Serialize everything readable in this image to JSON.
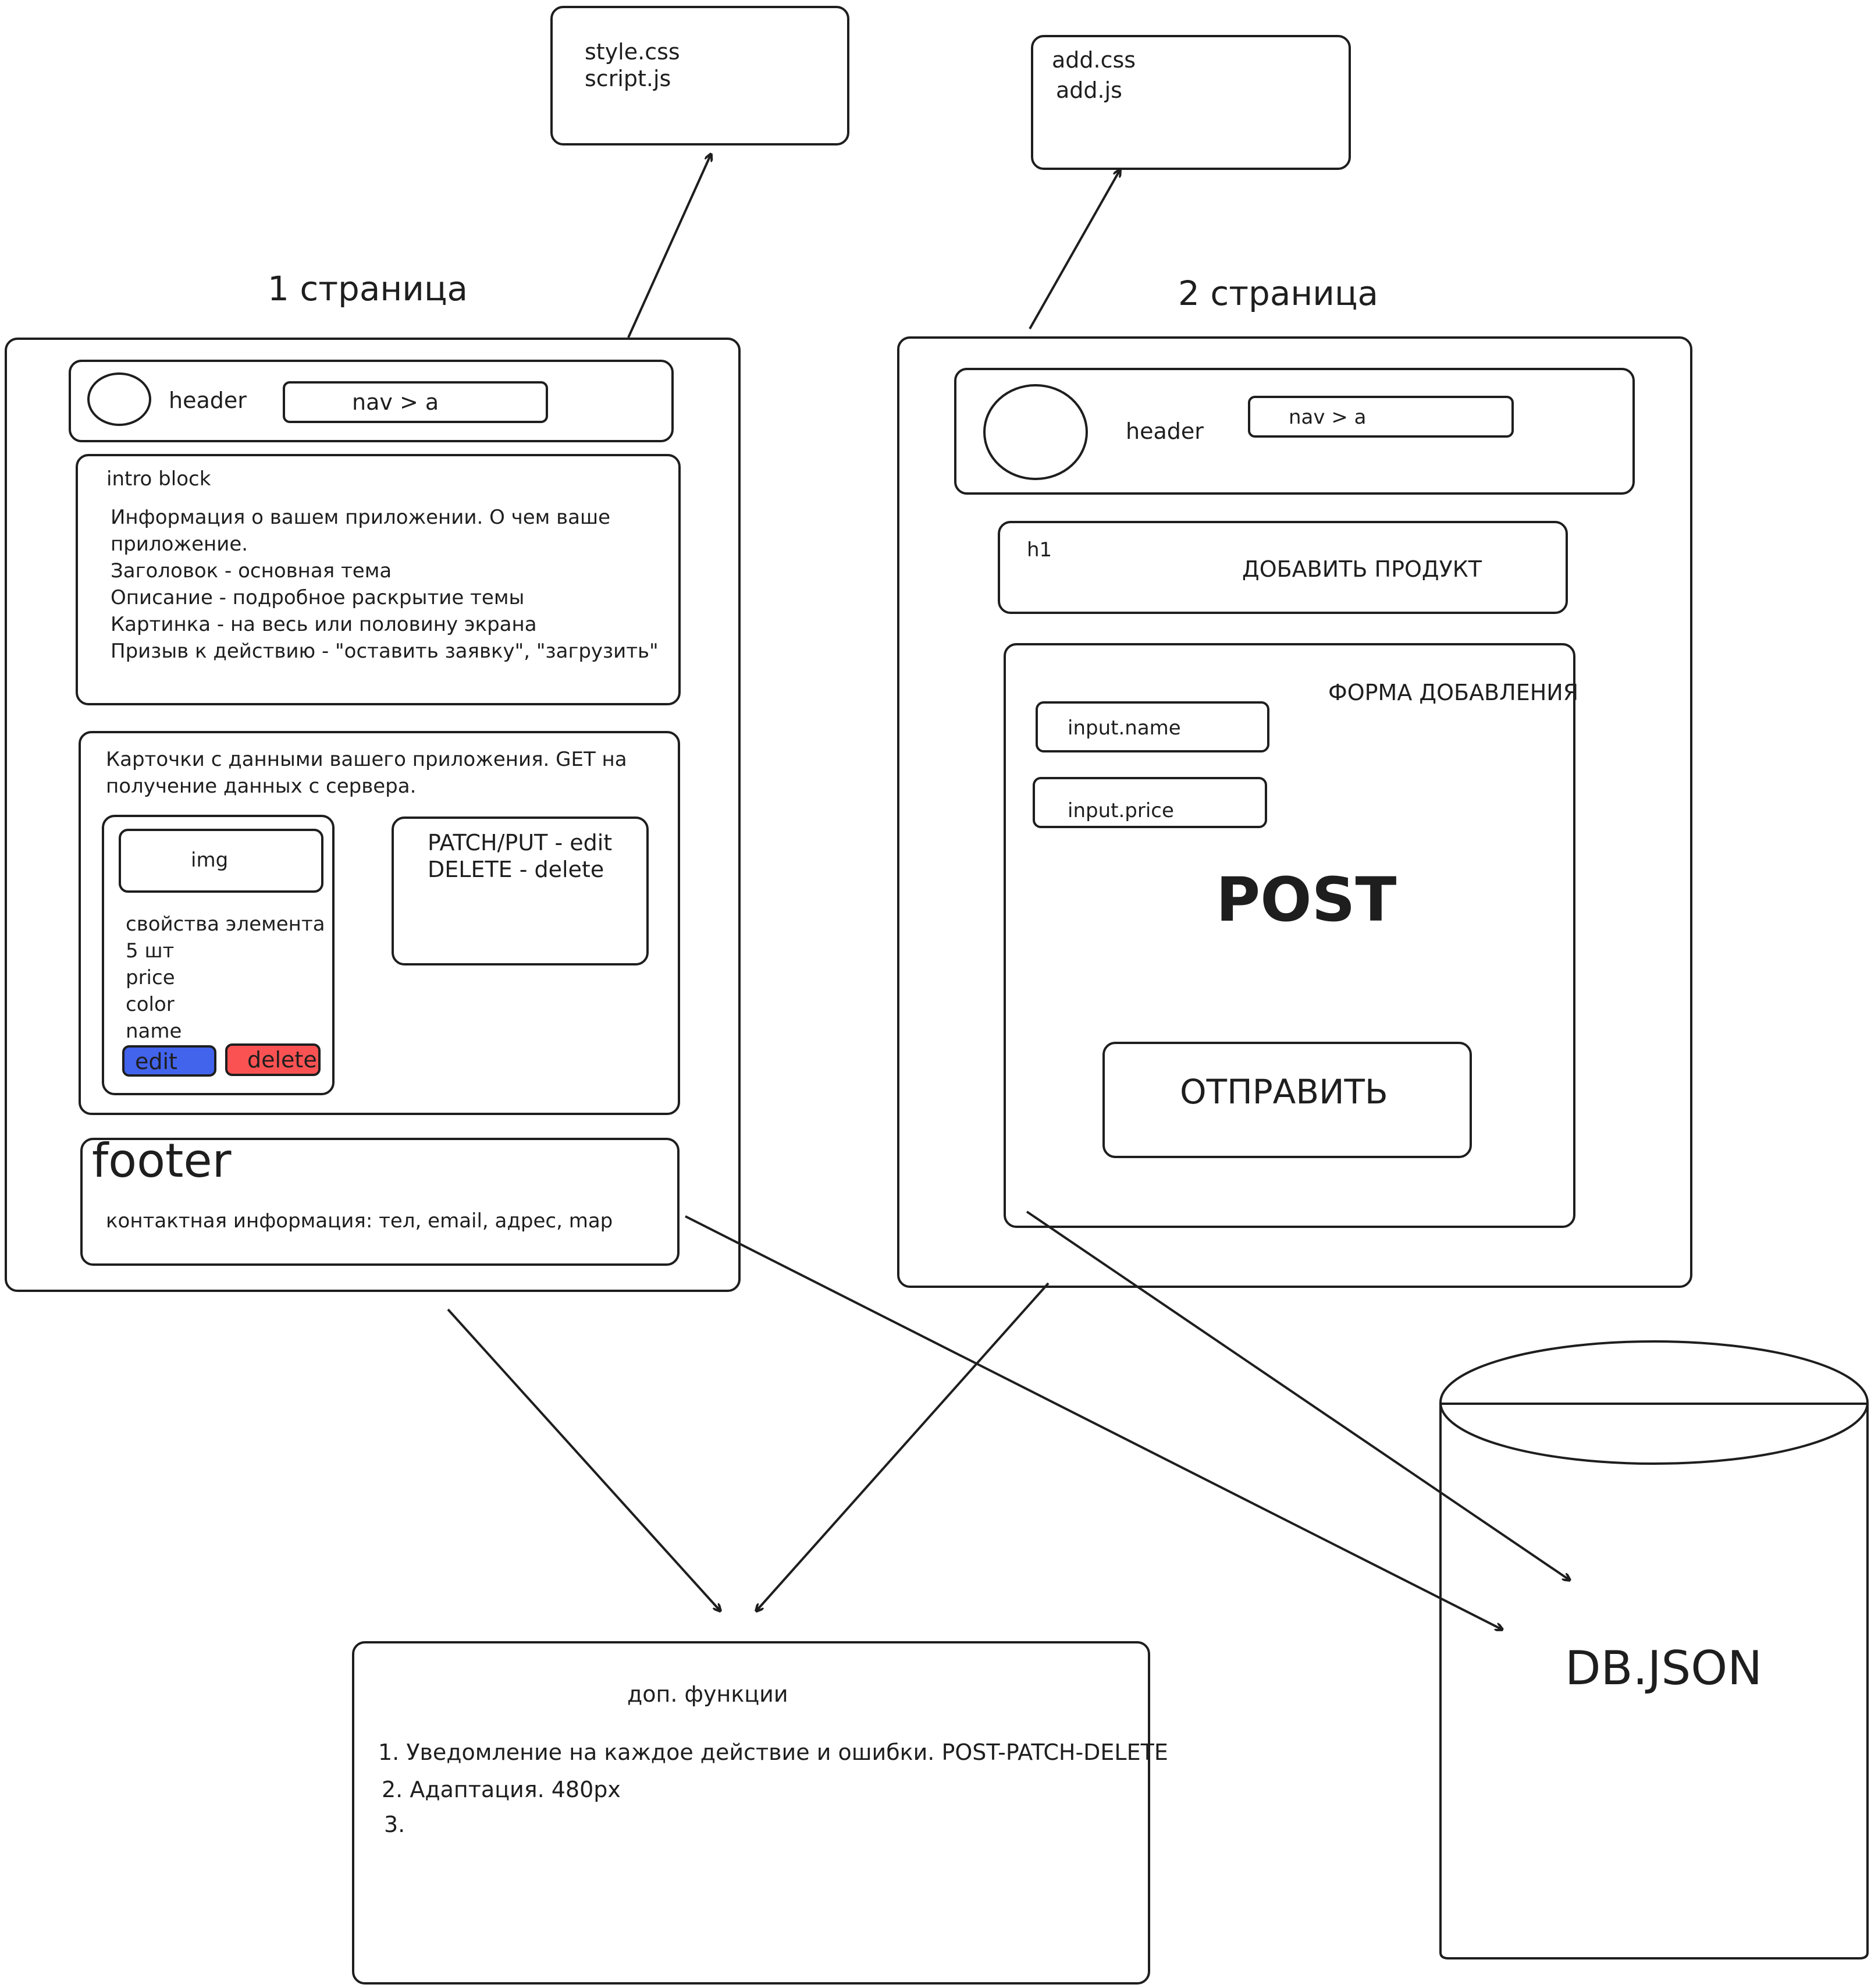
{
  "files_box_1": {
    "lines": [
      "style.css",
      "script.js"
    ]
  },
  "files_box_2": {
    "lines": [
      "add.css",
      "add.js"
    ]
  },
  "page1": {
    "title": "1 страница",
    "header": {
      "label": "header",
      "nav": "nav > a"
    },
    "intro": {
      "label": "intro block",
      "text": "Информация о вашем приложении. О чем ваше\nприложение.\nЗаголовок - основная тема\nОписание - подробное раскрытие темы\nКартинка - на весь или половину экрана\nПризыв к действию - \"оставить заявку\", \"загрузить\""
    },
    "cards": {
      "text": "Карточки с данными вашего приложения. GET на\nполучение данных с сервера.",
      "card": {
        "img": "img",
        "props": "свойства элемента\n5 шт\nprice\ncolor\nname",
        "edit_button": "edit",
        "delete_button": "delete"
      },
      "methods": "PATCH/PUT - edit\nDELETE - delete"
    },
    "footer": {
      "title": "footer",
      "text": "контактная информация: тел, email, адрес, map"
    }
  },
  "page2": {
    "title": "2 страница",
    "header": {
      "label": "header",
      "nav": "nav > a"
    },
    "h1_block": {
      "tag": "h1",
      "text": "ДОБАВИТЬ ПРОДУКТ"
    },
    "form": {
      "title": "ФОРМА ДОБАВЛЕНИЯ",
      "input_name": "input.name",
      "input_price": "input.price",
      "method": "POST",
      "submit": "ОТПРАВИТЬ"
    }
  },
  "extras": {
    "title": "доп. функции",
    "items": [
      "1. Уведомление на каждое действие и ошибки. POST-PATCH-DELETE",
      "2. Адаптация. 480px",
      "3."
    ]
  },
  "database": {
    "label": "DB.JSON"
  },
  "colors": {
    "stroke": "#1e1e1e",
    "edit_fill": "#4263eb",
    "delete_fill": "#fa5252"
  }
}
